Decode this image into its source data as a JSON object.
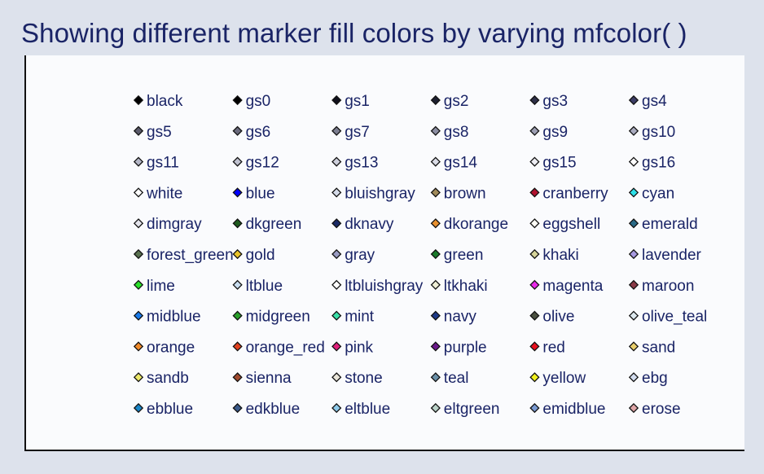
{
  "chart_data": {
    "type": "scatter",
    "title": "Showing different marker fill colors by varying mfcolor( )",
    "xlabel": "",
    "ylabel": "",
    "grid": false,
    "legend": "none",
    "marker": "diamond",
    "columns": 6,
    "rows": 11,
    "points": [
      {
        "label": "black",
        "row": 1,
        "col": 1,
        "fill": "#000000"
      },
      {
        "label": "gs0",
        "row": 1,
        "col": 2,
        "fill": "#000000"
      },
      {
        "label": "gs1",
        "row": 1,
        "col": 3,
        "fill": "#10101c"
      },
      {
        "label": "gs2",
        "row": 1,
        "col": 4,
        "fill": "#1e2030"
      },
      {
        "label": "gs3",
        "row": 1,
        "col": 5,
        "fill": "#2e3048"
      },
      {
        "label": "gs4",
        "row": 1,
        "col": 6,
        "fill": "#3c3d66"
      },
      {
        "label": "gs5",
        "row": 2,
        "col": 1,
        "fill": "#5a5a6a"
      },
      {
        "label": "gs6",
        "row": 2,
        "col": 2,
        "fill": "#6a6a7c"
      },
      {
        "label": "gs7",
        "row": 2,
        "col": 3,
        "fill": "#7c7e90"
      },
      {
        "label": "gs8",
        "row": 2,
        "col": 4,
        "fill": "#8c8ea2"
      },
      {
        "label": "gs9",
        "row": 2,
        "col": 5,
        "fill": "#9c9eb2"
      },
      {
        "label": "gs10",
        "row": 2,
        "col": 6,
        "fill": "#a9abbf"
      },
      {
        "label": "gs11",
        "row": 3,
        "col": 1,
        "fill": "#b4b6c6"
      },
      {
        "label": "gs12",
        "row": 3,
        "col": 2,
        "fill": "#c0c2d0"
      },
      {
        "label": "gs13",
        "row": 3,
        "col": 3,
        "fill": "#cdcfdb"
      },
      {
        "label": "gs14",
        "row": 3,
        "col": 4,
        "fill": "#dadce6"
      },
      {
        "label": "gs15",
        "row": 3,
        "col": 5,
        "fill": "#eeeef4"
      },
      {
        "label": "gs16",
        "row": 3,
        "col": 6,
        "fill": "#ffffff"
      },
      {
        "label": "white",
        "row": 4,
        "col": 1,
        "fill": "#ffffff"
      },
      {
        "label": "blue",
        "row": 4,
        "col": 2,
        "fill": "#0000ff"
      },
      {
        "label": "bluishgray",
        "row": 4,
        "col": 3,
        "fill": "#d4dae8"
      },
      {
        "label": "brown",
        "row": 4,
        "col": 4,
        "fill": "#a08a5a"
      },
      {
        "label": "cranberry",
        "row": 4,
        "col": 5,
        "fill": "#b0122e"
      },
      {
        "label": "cyan",
        "row": 4,
        "col": 6,
        "fill": "#2ee0e8"
      },
      {
        "label": "dimgray",
        "row": 5,
        "col": 1,
        "fill": "#e4e4ec"
      },
      {
        "label": "dkgreen",
        "row": 5,
        "col": 2,
        "fill": "#1e5a1e"
      },
      {
        "label": "dknavy",
        "row": 5,
        "col": 3,
        "fill": "#1a2a66"
      },
      {
        "label": "dkorange",
        "row": 5,
        "col": 4,
        "fill": "#e8902e"
      },
      {
        "label": "eggshell",
        "row": 5,
        "col": 5,
        "fill": "#fffef6"
      },
      {
        "label": "emerald",
        "row": 5,
        "col": 6,
        "fill": "#2a6a86"
      },
      {
        "label": "forest_green",
        "row": 6,
        "col": 1,
        "fill": "#5a7250"
      },
      {
        "label": "gold",
        "row": 6,
        "col": 2,
        "fill": "#e8c22a"
      },
      {
        "label": "gray",
        "row": 6,
        "col": 3,
        "fill": "#9a9cc2"
      },
      {
        "label": "green",
        "row": 6,
        "col": 4,
        "fill": "#1a7a2a"
      },
      {
        "label": "khaki",
        "row": 6,
        "col": 5,
        "fill": "#d6d49a"
      },
      {
        "label": "lavender",
        "row": 6,
        "col": 6,
        "fill": "#a89ae0"
      },
      {
        "label": "lime",
        "row": 7,
        "col": 1,
        "fill": "#2ae02a"
      },
      {
        "label": "ltblue",
        "row": 7,
        "col": 2,
        "fill": "#c8dcee"
      },
      {
        "label": "ltbluishgray",
        "row": 7,
        "col": 3,
        "fill": "#ffffff"
      },
      {
        "label": "ltkhaki",
        "row": 7,
        "col": 4,
        "fill": "#eeeed6"
      },
      {
        "label": "magenta",
        "row": 7,
        "col": 5,
        "fill": "#e82ae8"
      },
      {
        "label": "maroon",
        "row": 7,
        "col": 6,
        "fill": "#8a3a46"
      },
      {
        "label": "midblue",
        "row": 8,
        "col": 1,
        "fill": "#1a7ae8"
      },
      {
        "label": "midgreen",
        "row": 8,
        "col": 2,
        "fill": "#2aa02a"
      },
      {
        "label": "mint",
        "row": 8,
        "col": 3,
        "fill": "#3ae0a8"
      },
      {
        "label": "navy",
        "row": 8,
        "col": 4,
        "fill": "#1e3a86"
      },
      {
        "label": "olive",
        "row": 8,
        "col": 5,
        "fill": "#4a5040"
      },
      {
        "label": "olive_teal",
        "row": 8,
        "col": 6,
        "fill": "#dce8ee"
      },
      {
        "label": "orange",
        "row": 9,
        "col": 1,
        "fill": "#f08a2a"
      },
      {
        "label": "orange_red",
        "row": 9,
        "col": 2,
        "fill": "#e0401e"
      },
      {
        "label": "pink",
        "row": 9,
        "col": 3,
        "fill": "#e0207a"
      },
      {
        "label": "purple",
        "row": 9,
        "col": 4,
        "fill": "#6a1a8a"
      },
      {
        "label": "red",
        "row": 9,
        "col": 5,
        "fill": "#e8101e"
      },
      {
        "label": "sand",
        "row": 9,
        "col": 6,
        "fill": "#e8ce6a"
      },
      {
        "label": "sandb",
        "row": 10,
        "col": 1,
        "fill": "#ece86a"
      },
      {
        "label": "sienna",
        "row": 10,
        "col": 2,
        "fill": "#a04a2e"
      },
      {
        "label": "stone",
        "row": 10,
        "col": 3,
        "fill": "#eae6da"
      },
      {
        "label": "teal",
        "row": 10,
        "col": 4,
        "fill": "#6a90a8"
      },
      {
        "label": "yellow",
        "row": 10,
        "col": 5,
        "fill": "#f0f01e"
      },
      {
        "label": "ebg",
        "row": 10,
        "col": 6,
        "fill": "#d2dcee"
      },
      {
        "label": "ebblue",
        "row": 11,
        "col": 1,
        "fill": "#1a86c8"
      },
      {
        "label": "edkblue",
        "row": 11,
        "col": 2,
        "fill": "#3a5a8a"
      },
      {
        "label": "eltblue",
        "row": 11,
        "col": 3,
        "fill": "#8ecaea"
      },
      {
        "label": "eltgreen",
        "row": 11,
        "col": 4,
        "fill": "#bad2c8"
      },
      {
        "label": "emidblue",
        "row": 11,
        "col": 5,
        "fill": "#7a9ad2"
      },
      {
        "label": "erose",
        "row": 11,
        "col": 6,
        "fill": "#e0a6a8"
      }
    ]
  },
  "colors": {
    "background": "#dde2ec",
    "plot_background": "#fafbfd",
    "text": "#1a2466",
    "axis": "#111111"
  }
}
